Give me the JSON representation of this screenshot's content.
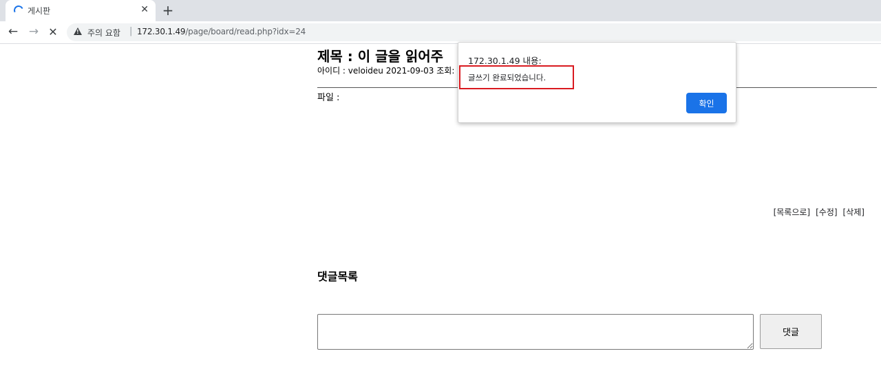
{
  "browser": {
    "tab": {
      "title": "게시판",
      "close_glyph": "✕"
    },
    "new_tab_glyph": "+",
    "nav": {
      "back_glyph": "←",
      "forward_glyph": "→",
      "stop_glyph": "✕"
    },
    "address": {
      "security_label": "주의 요함",
      "separator": "|",
      "host": "172.30.1.49",
      "path": "/page/board/read.php?idx=24"
    }
  },
  "post": {
    "title": "제목 : 이 글을 읽어주",
    "meta": "아이디 : veloideu 2021-09-03 조회:",
    "file_label": "파일 :"
  },
  "actions": {
    "list": "[목록으로]",
    "edit": "[수정]",
    "delete": "[삭제]"
  },
  "comments": {
    "heading": "댓글목록",
    "input_value": "",
    "submit_label": "댓글"
  },
  "dialog": {
    "origin": "172.30.1.49 내용:",
    "message": "글쓰기 완료되었습니다.",
    "ok_label": "확인",
    "highlight_color": "#d9191f"
  },
  "colors": {
    "accent": "#1a73e8",
    "tabstrip": "#dee1e6"
  }
}
